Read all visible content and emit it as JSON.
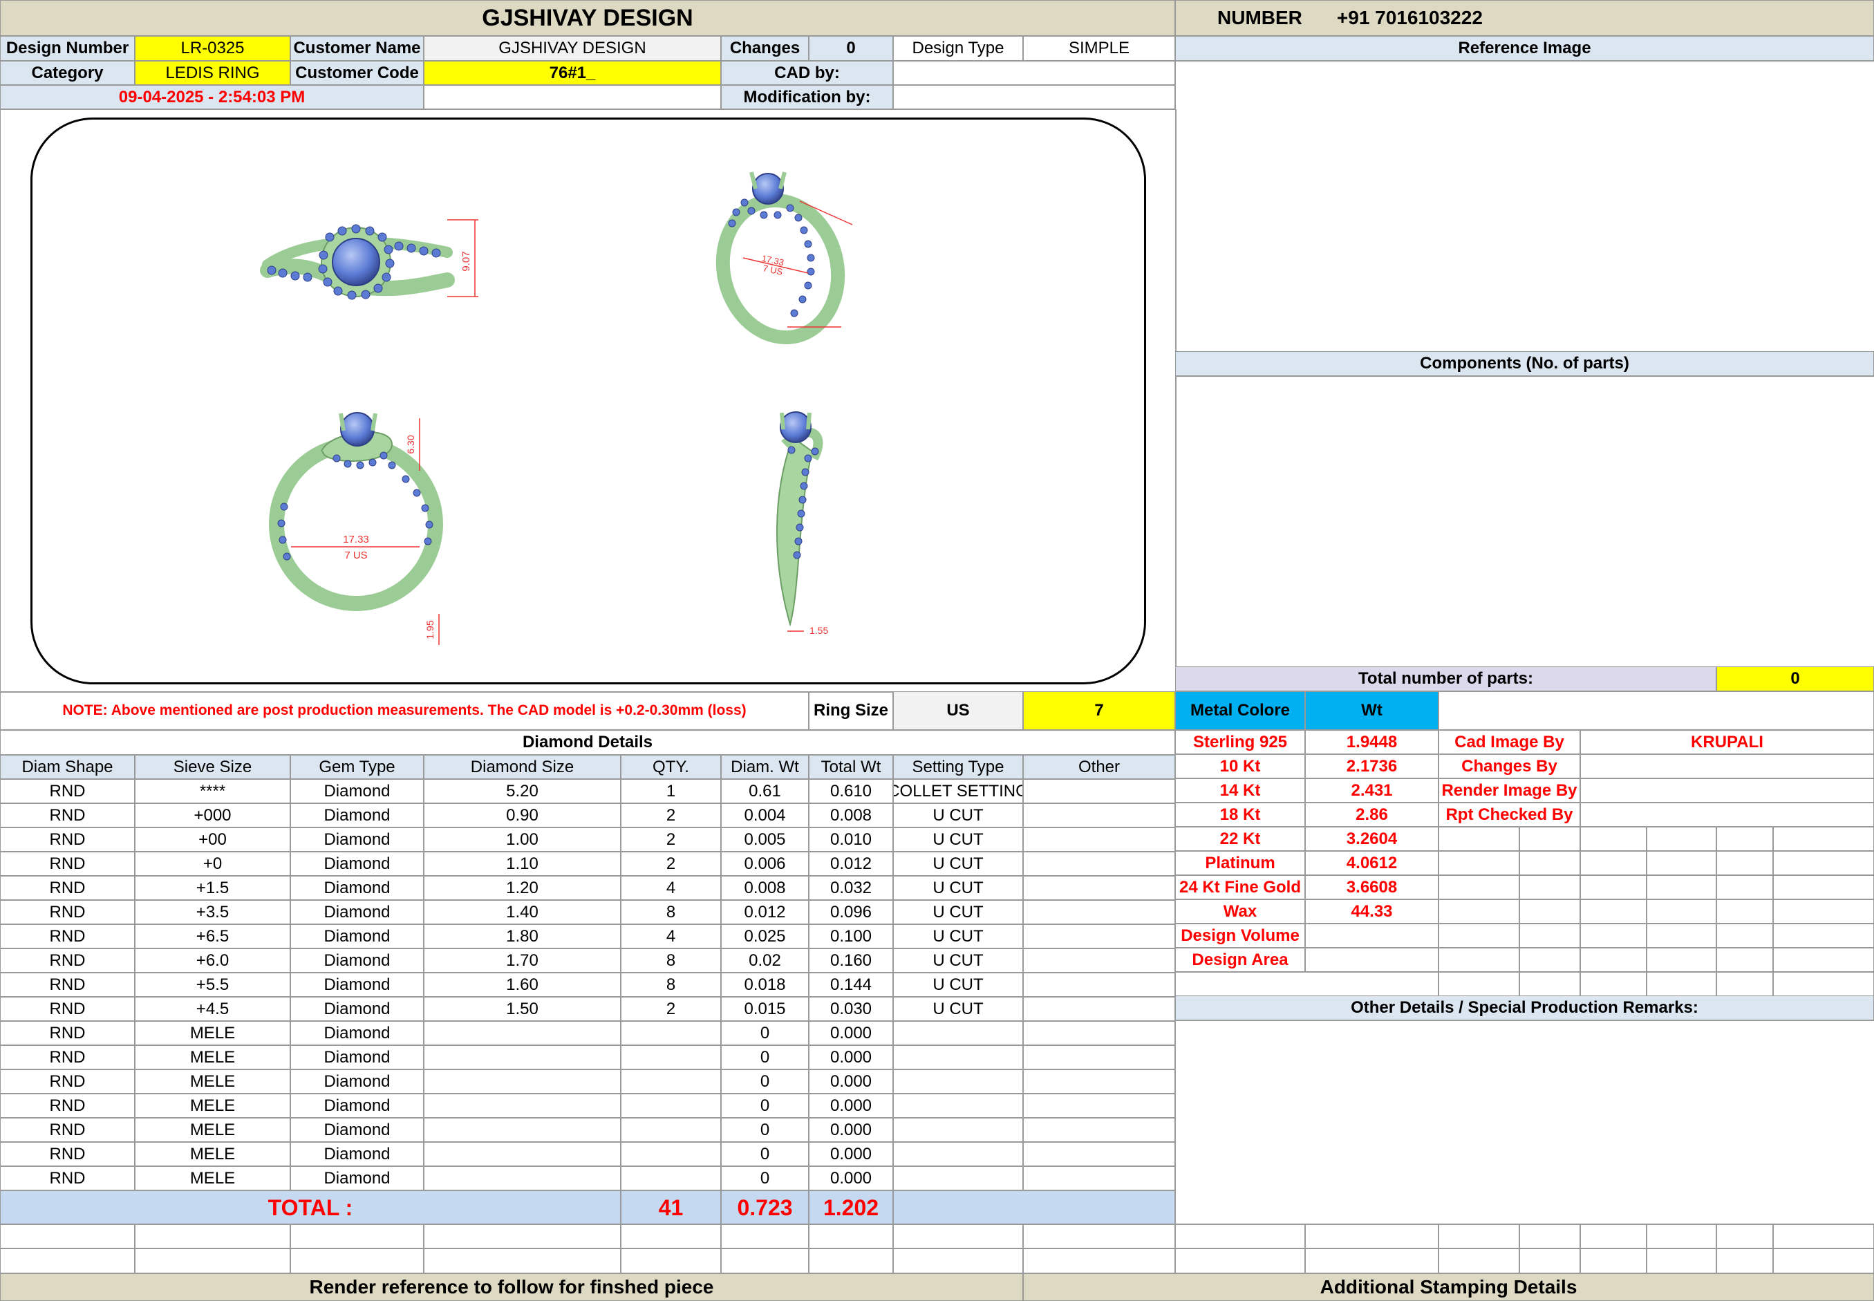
{
  "header": {
    "title": "GJSHIVAY DESIGN",
    "number_label": "NUMBER",
    "number_value": "+91 7016103222"
  },
  "info": {
    "design_number_label": "Design Number",
    "design_number": "LR-0325",
    "customer_name_label": "Customer Name",
    "customer_name": "GJSHIVAY DESIGN",
    "changes_label": "Changes",
    "changes": "0",
    "design_type_label": "Design Type",
    "design_type": "SIMPLE",
    "category_label": "Category",
    "category": "LEDIS RING",
    "customer_code_label": "Customer Code",
    "customer_code": "76#1_",
    "cad_by_label": "CAD by:",
    "modification_by_label": "Modification by:",
    "datetime": "09-04-2025 - 2:54:03 PM"
  },
  "drawing": {
    "dim_top_height": "9.07",
    "dim_side_1": "17.33",
    "dim_side_2": "7 US",
    "dim_head_height": "6.30",
    "dim_inner_1": "17.33",
    "dim_inner_2": "7 US",
    "dim_shank": "1.95",
    "dim_width": "1.55"
  },
  "note": "NOTE: Above mentioned are post production measurements. The CAD model is +0.2-0.30mm (loss)",
  "ring_size": {
    "label": "Ring Size",
    "unit": "US",
    "value": "7"
  },
  "diamond_details": {
    "title": "Diamond Details",
    "headers": [
      "Diam Shape",
      "Sieve Size",
      "Gem Type",
      "Diamond Size",
      "QTY.",
      "Diam. Wt",
      "Total Wt",
      "Setting Type",
      "Other"
    ],
    "rows": [
      [
        "RND",
        "****",
        "Diamond",
        "5.20",
        "1",
        "0.61",
        "0.610",
        "COLLET SETTING",
        ""
      ],
      [
        "RND",
        "+000",
        "Diamond",
        "0.90",
        "2",
        "0.004",
        "0.008",
        "U CUT",
        ""
      ],
      [
        "RND",
        "+00",
        "Diamond",
        "1.00",
        "2",
        "0.005",
        "0.010",
        "U CUT",
        ""
      ],
      [
        "RND",
        "+0",
        "Diamond",
        "1.10",
        "2",
        "0.006",
        "0.012",
        "U CUT",
        ""
      ],
      [
        "RND",
        "+1.5",
        "Diamond",
        "1.20",
        "4",
        "0.008",
        "0.032",
        "U CUT",
        ""
      ],
      [
        "RND",
        "+3.5",
        "Diamond",
        "1.40",
        "8",
        "0.012",
        "0.096",
        "U CUT",
        ""
      ],
      [
        "RND",
        "+6.5",
        "Diamond",
        "1.80",
        "4",
        "0.025",
        "0.100",
        "U CUT",
        ""
      ],
      [
        "RND",
        "+6.0",
        "Diamond",
        "1.70",
        "8",
        "0.02",
        "0.160",
        "U CUT",
        ""
      ],
      [
        "RND",
        "+5.5",
        "Diamond",
        "1.60",
        "8",
        "0.018",
        "0.144",
        "U CUT",
        ""
      ],
      [
        "RND",
        "+4.5",
        "Diamond",
        "1.50",
        "2",
        "0.015",
        "0.030",
        "U CUT",
        ""
      ],
      [
        "RND",
        "MELE",
        "Diamond",
        "",
        "",
        "0",
        "0.000",
        "",
        ""
      ],
      [
        "RND",
        "MELE",
        "Diamond",
        "",
        "",
        "0",
        "0.000",
        "",
        ""
      ],
      [
        "RND",
        "MELE",
        "Diamond",
        "",
        "",
        "0",
        "0.000",
        "",
        ""
      ],
      [
        "RND",
        "MELE",
        "Diamond",
        "",
        "",
        "0",
        "0.000",
        "",
        ""
      ],
      [
        "RND",
        "MELE",
        "Diamond",
        "",
        "",
        "0",
        "0.000",
        "",
        ""
      ],
      [
        "RND",
        "MELE",
        "Diamond",
        "",
        "",
        "0",
        "0.000",
        "",
        ""
      ],
      [
        "RND",
        "MELE",
        "Diamond",
        "",
        "",
        "0",
        "0.000",
        "",
        ""
      ]
    ],
    "total_label": "TOTAL :",
    "total_qty": "41",
    "total_diam_wt": "0.723",
    "total_wt": "1.202"
  },
  "reference_image_title": "Reference Image",
  "components_title": "Components (No. of parts)",
  "total_parts_label": "Total number of parts:",
  "total_parts": "0",
  "metal": {
    "color_label": "Metal Colore",
    "wt_label": "Wt",
    "rows": [
      [
        "Sterling 925",
        "1.9448"
      ],
      [
        "10 Kt",
        "2.1736"
      ],
      [
        "14 Kt",
        "2.431"
      ],
      [
        "18 Kt",
        "2.86"
      ],
      [
        "22 Kt",
        "3.2604"
      ],
      [
        "Platinum",
        "4.0612"
      ],
      [
        "24 Kt Fine Gold",
        "3.6608"
      ],
      [
        "Wax",
        "44.33"
      ],
      [
        "Design Volume",
        ""
      ],
      [
        "Design Area",
        ""
      ]
    ]
  },
  "credits": [
    [
      "Cad Image By",
      "KRUPALI"
    ],
    [
      "Changes By",
      ""
    ],
    [
      "Render Image By",
      ""
    ],
    [
      "Rpt Checked By",
      ""
    ]
  ],
  "other_details_title": "Other Details / Special Production Remarks:",
  "footer": {
    "render_reference": "Render reference to follow for finshed piece",
    "stamping": "Additional Stamping Details"
  },
  "colors": {
    "header_bg": "#ddd9c3",
    "label_bg": "#dce6f1",
    "highlight_yellow": "#ffff00",
    "metal_header_bg": "#00b0f0",
    "accent_red": "#ff0000",
    "metal_green": "#a9d6a0",
    "stone_blue": "#5b7bd5"
  }
}
